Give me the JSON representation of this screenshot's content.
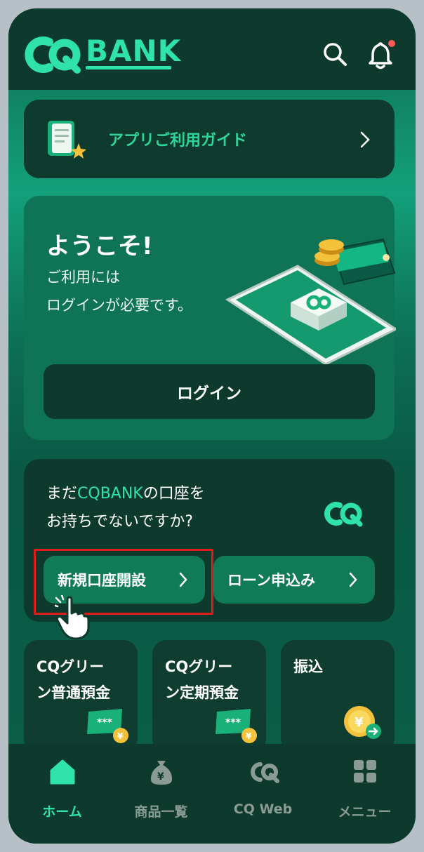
{
  "header": {
    "brand": "BANK",
    "icons": {
      "search": "search-icon",
      "notifications": "bell-icon"
    },
    "notification_dot_color": "#ff5a5a"
  },
  "guide": {
    "label": "アプリご利用ガイド"
  },
  "welcome": {
    "title": "ようこそ!",
    "subtitle_line1": "ご利用には",
    "subtitle_line2": "ログインが必要です。",
    "login_button": "ログイン"
  },
  "account": {
    "line1_prefix": "まだ",
    "line1_brand": "CQBANK",
    "line1_suffix": "の口座を",
    "line2": "お持ちでないですか?",
    "open_account_button": "新規口座開設",
    "loan_button": "ローン申込み"
  },
  "tiles": [
    {
      "line1": "CQグリー",
      "line2": "ン普通預金"
    },
    {
      "line1": "CQグリー",
      "line2": "ン定期預金"
    },
    {
      "line1": "振込",
      "line2": ""
    }
  ],
  "card_masks": [
    "***",
    "***"
  ],
  "currency_symbol": "¥",
  "bottom_nav": [
    {
      "label": "ホーム",
      "icon": "home-icon",
      "active": true
    },
    {
      "label": "商品一覧",
      "icon": "money-bag-icon",
      "active": false
    },
    {
      "label": "CQ Web",
      "icon": "cq-logo-icon",
      "active": false
    },
    {
      "label": "メニュー",
      "icon": "grid-menu-icon",
      "active": false
    }
  ],
  "colors": {
    "accent": "#2fe3a8",
    "dark": "#0d3a2d",
    "highlight": "#e11a1a",
    "inactive": "#8a9a94"
  }
}
